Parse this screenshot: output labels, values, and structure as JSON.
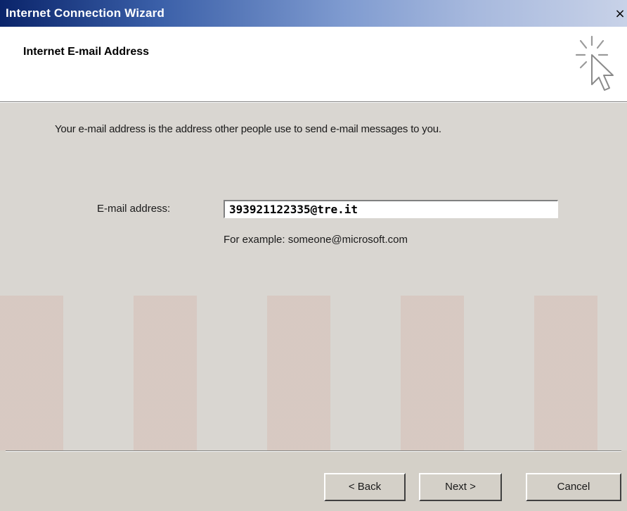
{
  "window": {
    "title": "Internet Connection Wizard",
    "close_glyph": "×"
  },
  "header": {
    "title": "Internet E-mail Address",
    "icon": "wizard-cursor-sparkle-icon"
  },
  "content": {
    "intro": "Your e-mail address is the address other people use to send e-mail messages to you.",
    "email_label": "E-mail address:",
    "email_value": "393921122335@tre.it",
    "example": "For example: someone@microsoft.com"
  },
  "buttons": {
    "back": "< Back",
    "next": "Next >",
    "cancel": "Cancel"
  },
  "colors": {
    "titlebar_start": "#0a246a",
    "face": "#d4d0c8"
  }
}
